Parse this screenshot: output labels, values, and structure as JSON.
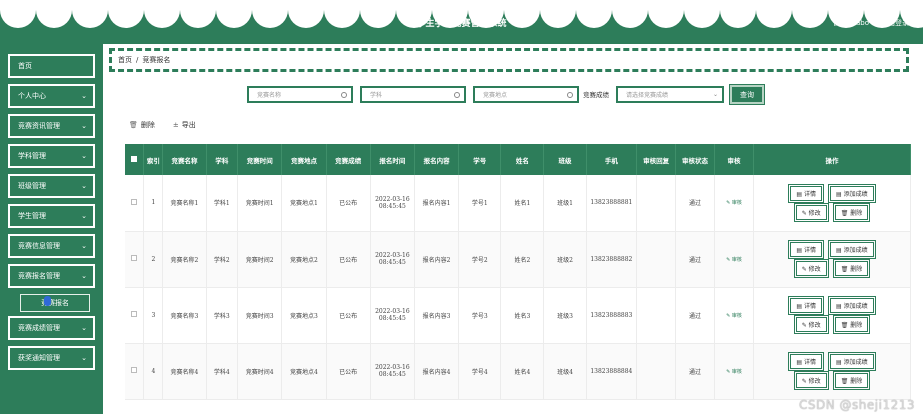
{
  "header": {
    "title": "学生学科竞赛管理系统",
    "admin_label": "管理员 abo",
    "logout_label": "退出登录"
  },
  "sidebar": {
    "items": [
      {
        "label": "首页",
        "has_arrow": false
      },
      {
        "label": "个人中心",
        "has_arrow": true
      },
      {
        "label": "竞赛资讯管理",
        "has_arrow": true
      },
      {
        "label": "学科管理",
        "has_arrow": true
      },
      {
        "label": "班级管理",
        "has_arrow": true
      },
      {
        "label": "学生管理",
        "has_arrow": true
      },
      {
        "label": "竞赛信息管理",
        "has_arrow": true
      },
      {
        "label": "竞赛报名管理",
        "has_arrow": true
      },
      {
        "label": "竞赛成绩管理",
        "has_arrow": true
      },
      {
        "label": "获奖通知管理",
        "has_arrow": true
      }
    ],
    "active_sub_item": "竞赛报名"
  },
  "breadcrumb": {
    "home": "首页",
    "separator": "/",
    "current": "竞赛报名"
  },
  "search": {
    "name_placeholder": "竞赛名称",
    "subject_placeholder": "学科",
    "location_placeholder": "竞赛地点",
    "result_label": "竞赛成绩",
    "result_placeholder": "请选择竞赛成绩",
    "query_label": "查询"
  },
  "actions": {
    "delete_label": "删除",
    "export_label": "导出"
  },
  "table": {
    "columns": [
      "索引",
      "竞赛名称",
      "学科",
      "竞赛时间",
      "竞赛地点",
      "竞赛成绩",
      "报名时间",
      "报名内容",
      "学号",
      "姓名",
      "班级",
      "手机",
      "审核回复",
      "审核状态",
      "审核",
      "操作"
    ],
    "rows": [
      {
        "index": "1",
        "name": "竞赛名称1",
        "subject": "学科1",
        "time": "竞赛时间1",
        "location": "竞赛地点1",
        "result": "已公布",
        "signup_time": "2022-03-16 08:45:45",
        "content": "报名内容1",
        "student_no": "学号1",
        "student_name": "姓名1",
        "class": "班级1",
        "phone": "13823888881",
        "reply": "",
        "status": "通过",
        "audit": "审核"
      },
      {
        "index": "2",
        "name": "竞赛名称2",
        "subject": "学科2",
        "time": "竞赛时间2",
        "location": "竞赛地点2",
        "result": "已公布",
        "signup_time": "2022-03-16 08:45:45",
        "content": "报名内容2",
        "student_no": "学号2",
        "student_name": "姓名2",
        "class": "班级2",
        "phone": "13823888882",
        "reply": "",
        "status": "通过",
        "audit": "审核"
      },
      {
        "index": "3",
        "name": "竞赛名称3",
        "subject": "学科3",
        "time": "竞赛时间3",
        "location": "竞赛地点3",
        "result": "已公布",
        "signup_time": "2022-03-16 08:45:45",
        "content": "报名内容3",
        "student_no": "学号3",
        "student_name": "姓名3",
        "class": "班级3",
        "phone": "13823888883",
        "reply": "",
        "status": "通过",
        "audit": "审核"
      },
      {
        "index": "4",
        "name": "竞赛名称4",
        "subject": "学科4",
        "time": "竞赛时间4",
        "location": "竞赛地点4",
        "result": "已公布",
        "signup_time": "2022-03-16 08:45:45",
        "content": "报名内容4",
        "student_no": "学号4",
        "student_name": "姓名4",
        "class": "班级4",
        "phone": "13823888884",
        "reply": "",
        "status": "通过",
        "audit": "审核"
      }
    ],
    "row_buttons": {
      "detail": "详情",
      "add_score": "添加成绩",
      "edit": "修改",
      "delete": "删除"
    }
  },
  "watermark": "CSDN @sheji1213",
  "colors": {
    "primary": "#2d7d5a",
    "background": "#ffffff"
  }
}
